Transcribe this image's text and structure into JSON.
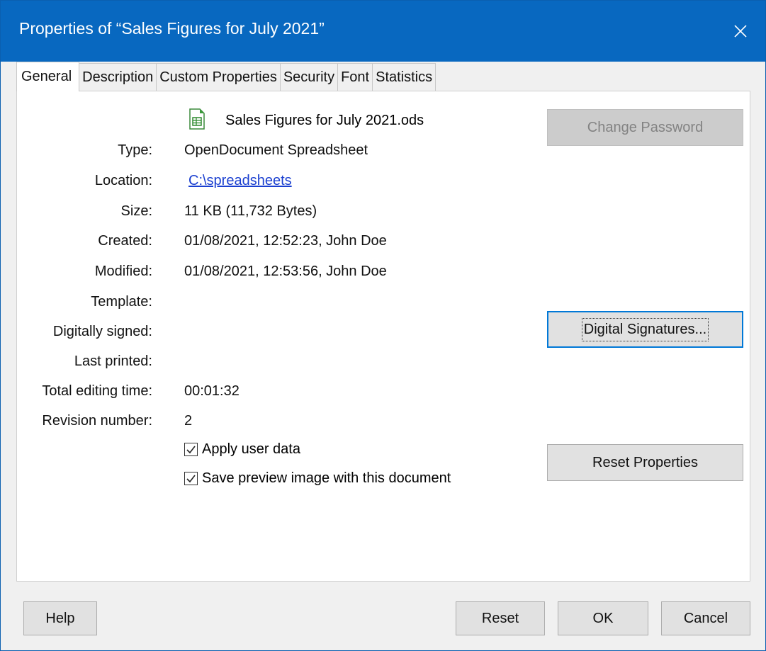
{
  "window": {
    "title": "Properties of “Sales Figures for July 2021”",
    "close_icon": "close-icon"
  },
  "tabs": [
    {
      "label": "General",
      "active": true
    },
    {
      "label": "Description",
      "active": false
    },
    {
      "label": "Custom Properties",
      "active": false
    },
    {
      "label": "Security",
      "active": false
    },
    {
      "label": "Font",
      "active": false
    },
    {
      "label": "Statistics",
      "active": false
    }
  ],
  "general": {
    "file_icon": "spreadsheet-icon",
    "filename": "Sales Figures for July 2021.ods",
    "fields": {
      "type": {
        "label": "Type:",
        "value": "OpenDocument Spreadsheet"
      },
      "location": {
        "label": "Location:",
        "value": "C:\\spreadsheets"
      },
      "size": {
        "label": "Size:",
        "value": "11 KB (11,732 Bytes)"
      },
      "created": {
        "label": "Created:",
        "value": "01/08/2021, 12:52:23, John Doe"
      },
      "modified": {
        "label": "Modified:",
        "value": "01/08/2021, 12:53:56, John Doe"
      },
      "template": {
        "label": "Template:",
        "value": ""
      },
      "digitally_signed": {
        "label": "Digitally signed:",
        "value": ""
      },
      "last_printed": {
        "label": "Last printed:",
        "value": ""
      },
      "editing_time": {
        "label": "Total editing time:",
        "value": "00:01:32"
      },
      "revision": {
        "label": "Revision number:",
        "value": "2"
      }
    },
    "apply_user_data": {
      "label": "Apply user data",
      "checked": true
    },
    "save_preview": {
      "label": "Save preview image with this document",
      "checked": true
    },
    "buttons": {
      "change_password": "Change Password",
      "digital_signatures": "Digital Signatures...",
      "reset_properties": "Reset Properties"
    }
  },
  "footer": {
    "help": "Help",
    "reset": "Reset",
    "ok": "OK",
    "cancel": "Cancel"
  },
  "colors": {
    "titlebar": "#0868c0",
    "link": "#1a3fd0",
    "focus": "#0078d7"
  }
}
